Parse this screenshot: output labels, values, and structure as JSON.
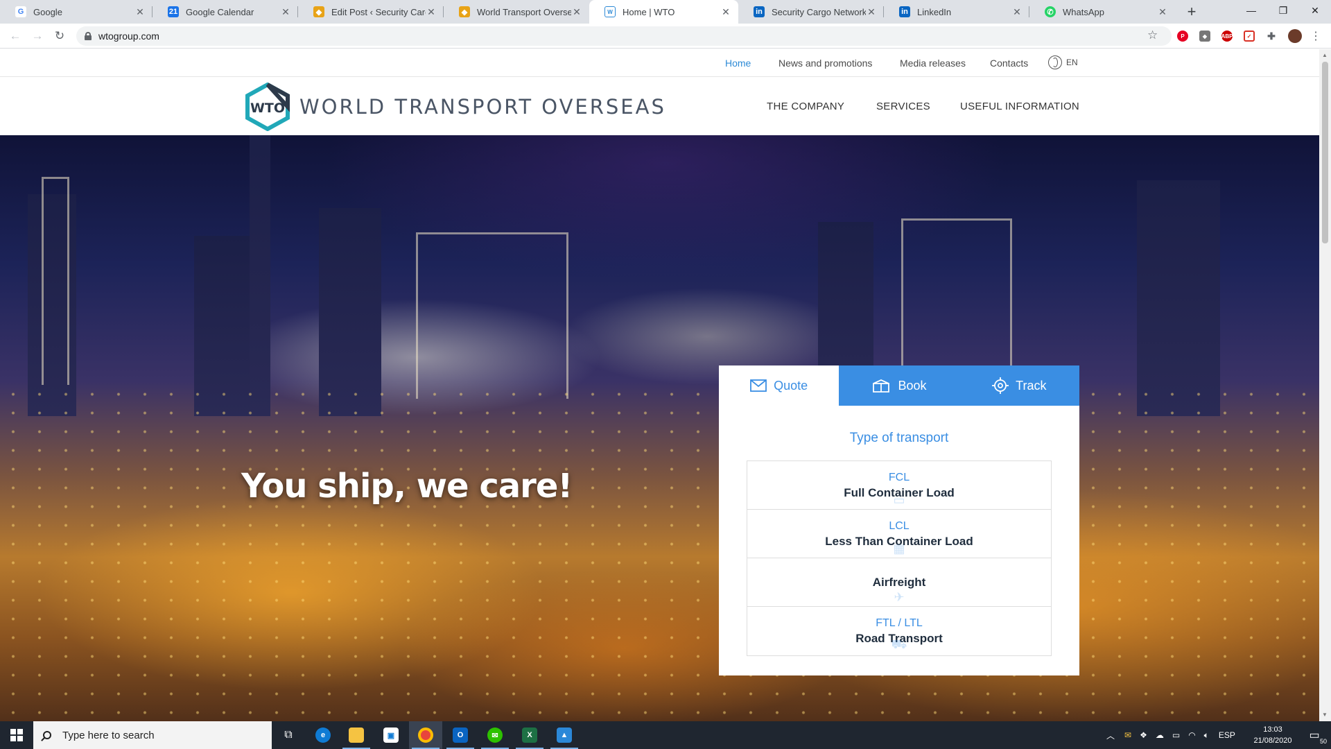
{
  "browser": {
    "tabs": [
      {
        "title": "Google",
        "favicon": "G",
        "color": "#4285f4"
      },
      {
        "title": "Google Calendar",
        "favicon": "21",
        "color": "#1a73e8"
      },
      {
        "title": "Edit Post ‹ Security Cargo N",
        "favicon": "◆",
        "color": "#e8a317"
      },
      {
        "title": "World Transport Overseas G",
        "favicon": "◆",
        "color": "#e8a317"
      },
      {
        "title": "Home | WTO",
        "favicon": "W",
        "color": "#2d8ad6"
      },
      {
        "title": "Security Cargo Network, Inc",
        "favicon": "in",
        "color": "#0a66c2"
      },
      {
        "title": "LinkedIn",
        "favicon": "in",
        "color": "#0a66c2"
      },
      {
        "title": "WhatsApp",
        "favicon": "✆",
        "color": "#25d366"
      }
    ],
    "url": "wtogroup.com"
  },
  "site": {
    "topnav": {
      "home": "Home",
      "news": "News and promotions",
      "media": "Media releases",
      "contacts": "Contacts",
      "lang": "EN"
    },
    "logo": {
      "mark": "WTO",
      "name": "WORLD TRANSPORT OVERSEAS"
    },
    "mainnav": {
      "company": "THE COMPANY",
      "services": "SERVICES",
      "info": "USEFUL INFORMATION"
    },
    "slogan": "You ship, we care!",
    "panel": {
      "tabs": {
        "quote": "Quote",
        "book": "Book",
        "track": "Track"
      },
      "heading": "Type of transport",
      "options": [
        {
          "code": "FCL",
          "name": "Full Container Load"
        },
        {
          "code": "LCL",
          "name": "Less Than Container Load"
        },
        {
          "code": "",
          "name": "Airfreight"
        },
        {
          "code": "FTL / LTL",
          "name": "Road Transport"
        }
      ]
    },
    "colors": {
      "accent": "#3a8ee3",
      "logo_teal": "#21a8b8"
    }
  },
  "taskbar": {
    "search_placeholder": "Type here to search",
    "lang": "ESP",
    "time": "13:03",
    "date": "21/08/2020",
    "notifications": "50"
  }
}
